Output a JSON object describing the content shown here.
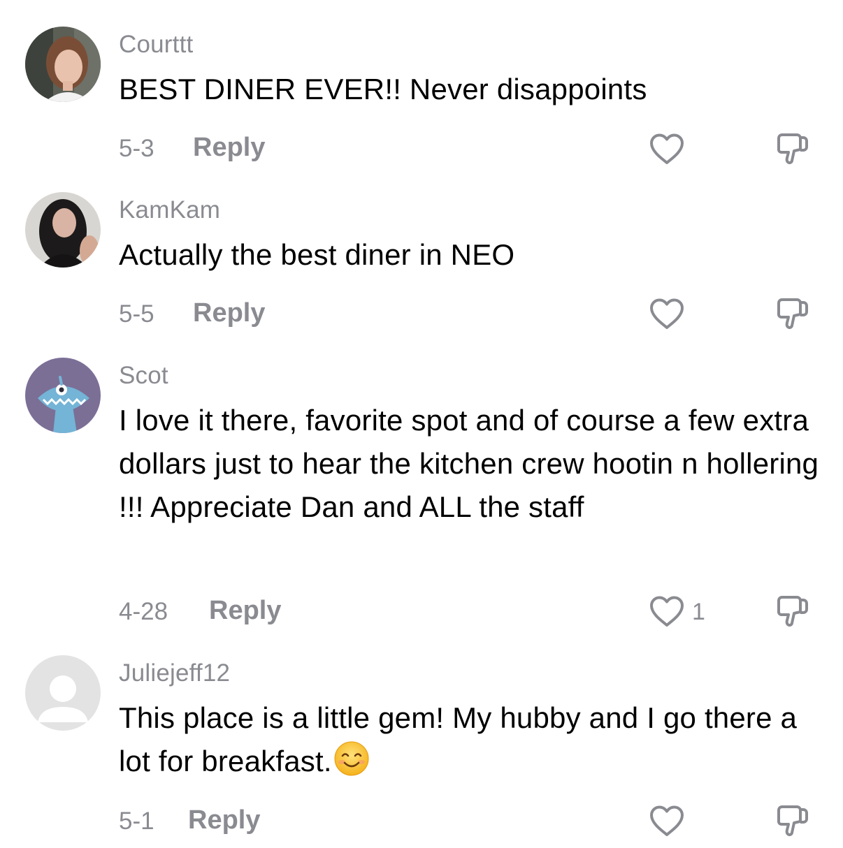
{
  "comments": [
    {
      "username": "Courttt",
      "text": "BEST DINER EVER!! Never disappoints",
      "date": "5-3",
      "reply_label": "Reply",
      "like_count": ""
    },
    {
      "username": "KamKam",
      "text": "Actually the best diner in NEO",
      "date": "5-5",
      "reply_label": "Reply",
      "like_count": ""
    },
    {
      "username": "Scot",
      "text": "I love it there, favorite spot and of course a few extra dollars just to hear the kitchen crew hootin n hollering !!! Appreciate Dan and ALL the staff",
      "date": "4-28",
      "reply_label": "Reply",
      "like_count": "1"
    },
    {
      "username": "Juliejeff12",
      "text": "This place is a little gem! My hubby and I go there a lot for breakfast.",
      "date": "5-1",
      "reply_label": "Reply",
      "like_count": ""
    }
  ],
  "icons": {
    "like": "heart-outline-icon",
    "dislike": "thumbs-down-outline-icon",
    "emoji": "smiling-face-icon"
  },
  "colors": {
    "secondary_text": "#8a8b91",
    "primary_text": "#000000",
    "icon": "#8a8b91",
    "scot_avatar_bg": "#7b6f96",
    "default_avatar_bg": "#e3e3e4"
  }
}
